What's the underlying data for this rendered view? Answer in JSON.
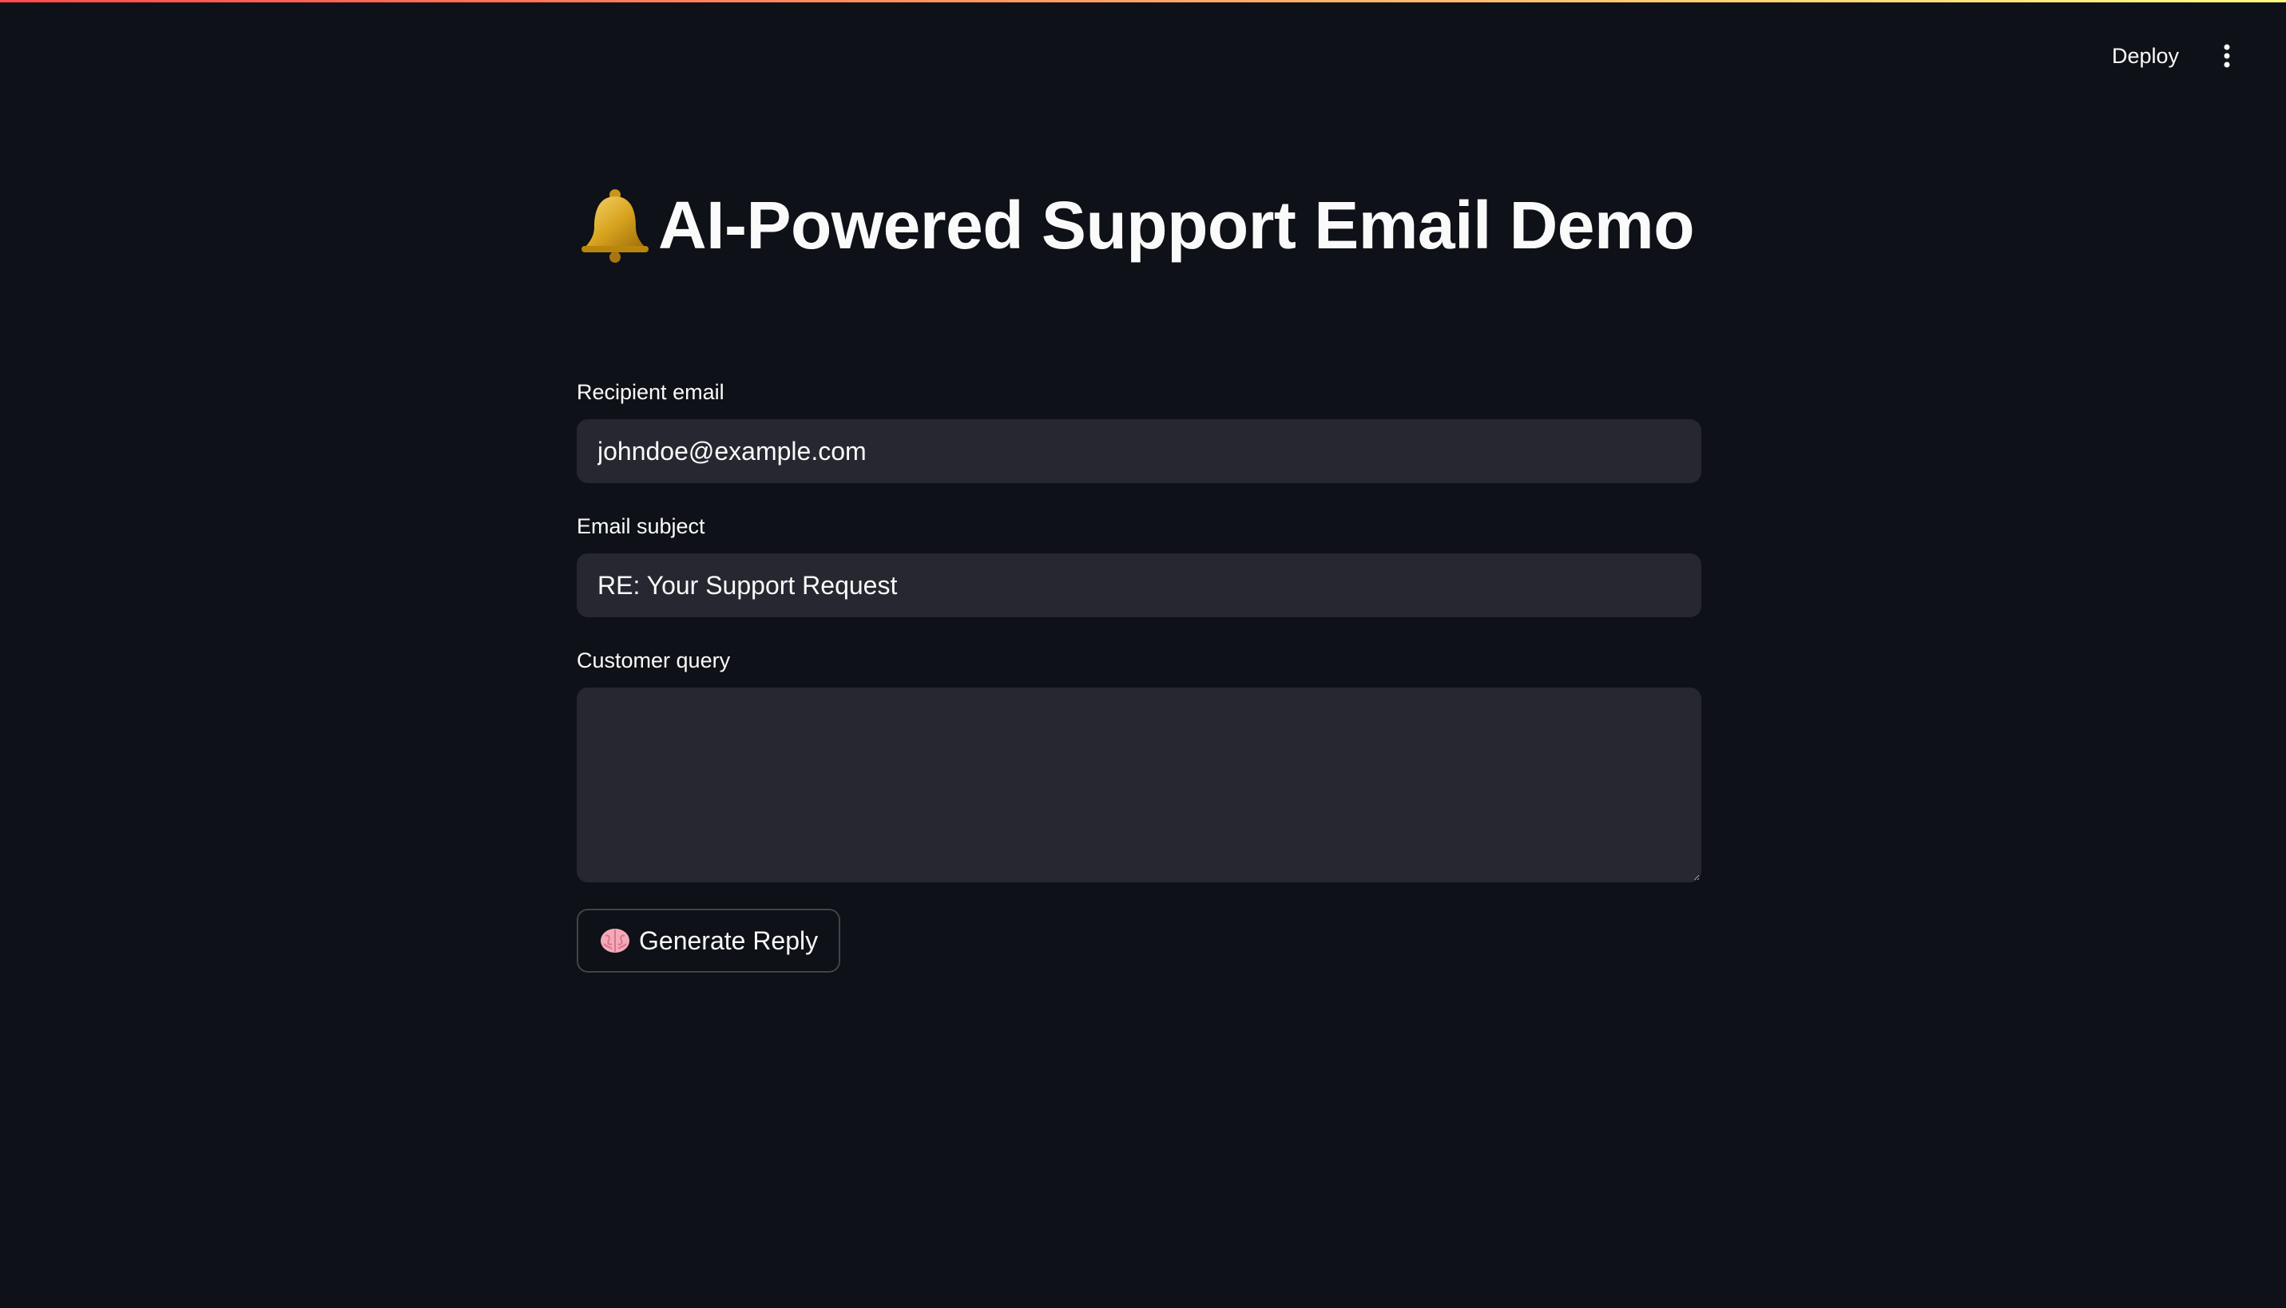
{
  "header": {
    "deploy_label": "Deploy",
    "menu_icon": "vertical-dots-icon"
  },
  "main": {
    "title": "AI-Powered Support Email Demo",
    "title_icon": "bell-icon"
  },
  "form": {
    "recipient_label": "Recipient email",
    "recipient_value": "johndoe@example.com",
    "subject_label": "Email subject",
    "subject_value": "RE: Your Support Request",
    "query_label": "Customer query",
    "query_value": "",
    "generate_button_label": "Generate Reply",
    "generate_button_icon": "brain-icon"
  },
  "colors": {
    "background": "#0e1117",
    "input_background": "#262730",
    "text": "#fafafa",
    "accent_gradient_start": "#ff4b4b",
    "accent_gradient_end": "#fffd80"
  }
}
